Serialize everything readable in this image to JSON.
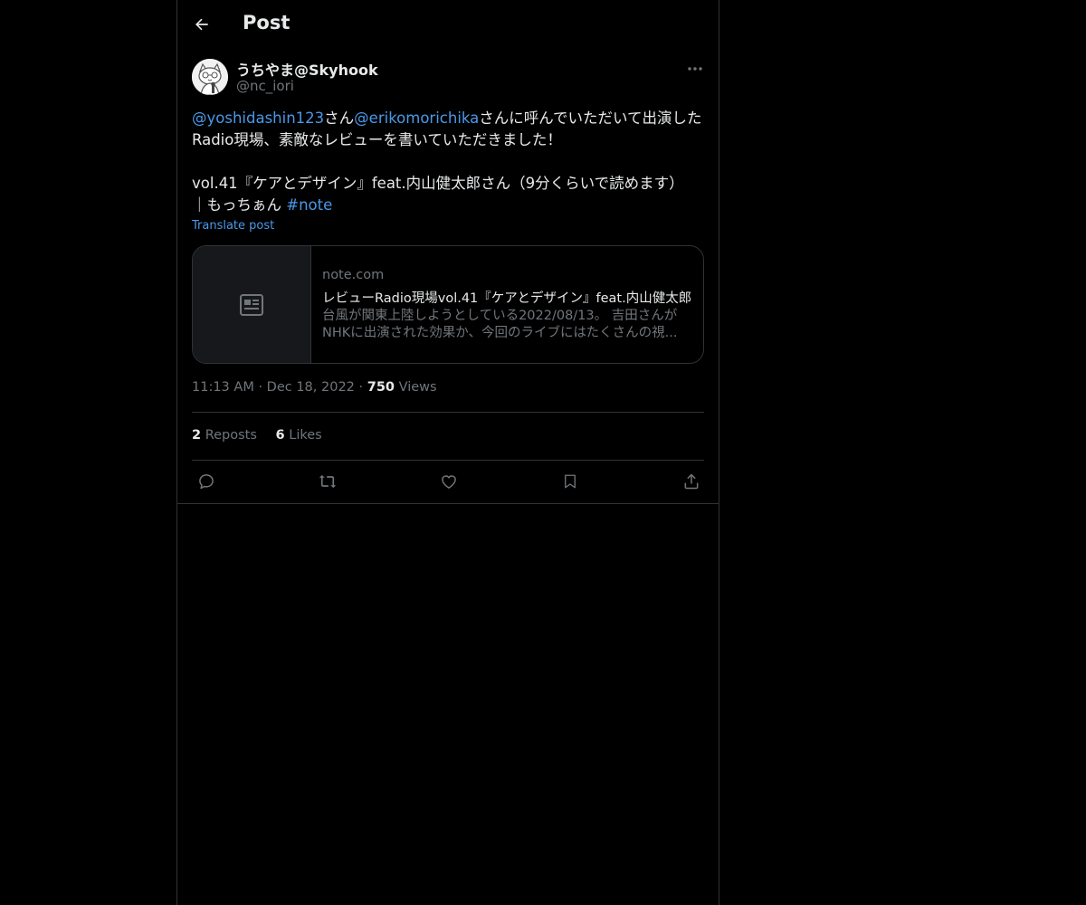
{
  "header": {
    "title": "Post",
    "back_icon": "arrow-left-icon"
  },
  "author": {
    "display_name": "うちやま@Skyhook",
    "handle": "@nc_iori",
    "more_icon": "more-horizontal-icon"
  },
  "post": {
    "mention1": "@yoshidashin123",
    "text1": "さん",
    "mention2": "@erikomorichika",
    "text2": "さんに呼んでいただいて出演した",
    "line2": "Radio現場、素敵なレビューを書いていただきました！",
    "line4": "vol.41『ケアとデザイン』feat.内山健太郎さん（9分くらいで読めます）",
    "line5": "｜もっちぁん ",
    "hashtag": "#note"
  },
  "translate_label": "Translate post",
  "link_card": {
    "domain": "note.com",
    "title": "レビューRadio現場vol.41『ケアとデザイン』feat.内山健太郎",
    "desc_line1": "台風が関東上陸しようとしている2022/08/13。 吉田さんが",
    "desc_line2": "NHKに出演された効果か、今回のライブにはたくさんの視...",
    "thumb_icon": "article-icon"
  },
  "meta": {
    "time": "11:13 AM",
    "sep": "·",
    "date": "Dec 18, 2022",
    "views_count": "750",
    "views_label": " Views"
  },
  "stats": {
    "reposts_count": "2",
    "reposts_label": " Reposts",
    "likes_count": "6",
    "likes_label": " Likes"
  },
  "actions": [
    "reply-icon",
    "repost-icon",
    "like-icon",
    "bookmark-icon",
    "share-icon"
  ],
  "colors": {
    "background": "#000000",
    "text": "#e7e9ea",
    "muted": "#71767b",
    "link": "#4a99e9",
    "border": "#2f3336"
  }
}
